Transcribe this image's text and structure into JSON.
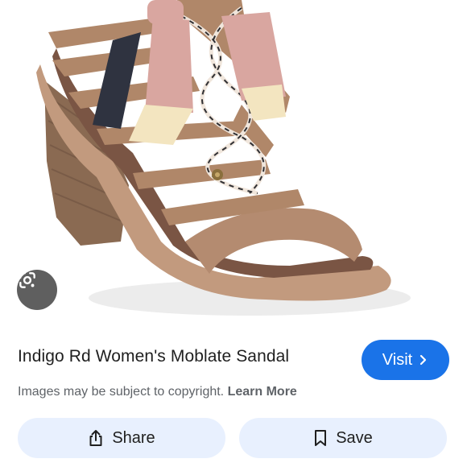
{
  "result": {
    "title": "Indigo Rd Women's Moblate Sandal",
    "visit_label": "Visit",
    "copyright_text": "Images may be subject to copyright.",
    "learn_more_label": "Learn More"
  },
  "actions": {
    "share_label": "Share",
    "save_label": "Save"
  },
  "icons": {
    "lens": "google-lens-icon",
    "visit_arrow": "chevron-right-icon",
    "share": "share-icon",
    "save": "bookmark-icon"
  },
  "colors": {
    "primary_button": "#1a73e8",
    "tonal_button": "#e8f0fe",
    "title_text": "#1f1f1f",
    "muted_text": "#5f6368"
  }
}
